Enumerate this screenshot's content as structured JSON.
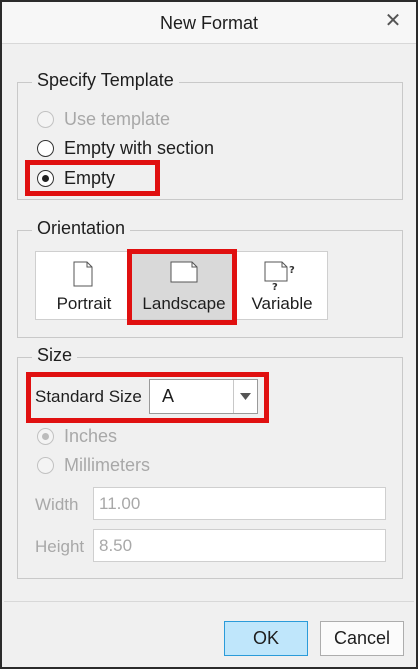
{
  "dialog": {
    "title": "New Format",
    "close_glyph": "✕"
  },
  "template_group": {
    "legend": "Specify Template",
    "options": [
      {
        "label": "Use template",
        "selected": false,
        "enabled": false
      },
      {
        "label": "Empty with section",
        "selected": false,
        "enabled": true
      },
      {
        "label": "Empty",
        "selected": true,
        "enabled": true
      }
    ]
  },
  "orientation_group": {
    "legend": "Orientation",
    "buttons": [
      {
        "label": "Portrait",
        "icon": "portrait-page-icon",
        "selected": false
      },
      {
        "label": "Landscape",
        "icon": "landscape-page-icon",
        "selected": true
      },
      {
        "label": "Variable",
        "icon": "variable-page-icon",
        "selected": false
      }
    ]
  },
  "size_group": {
    "legend": "Size",
    "standard_size_label": "Standard Size",
    "standard_size_value": "A",
    "units": [
      {
        "label": "Inches",
        "selected": true,
        "enabled": false
      },
      {
        "label": "Millimeters",
        "selected": false,
        "enabled": false
      }
    ],
    "width_label": "Width",
    "width_value": "11.00",
    "height_label": "Height",
    "height_value": "8.50"
  },
  "footer": {
    "ok_label": "OK",
    "cancel_label": "Cancel"
  },
  "colors": {
    "highlight": "#e01010",
    "ok_button_bg": "#bfe6fb",
    "ok_button_border": "#2b9bd9"
  }
}
